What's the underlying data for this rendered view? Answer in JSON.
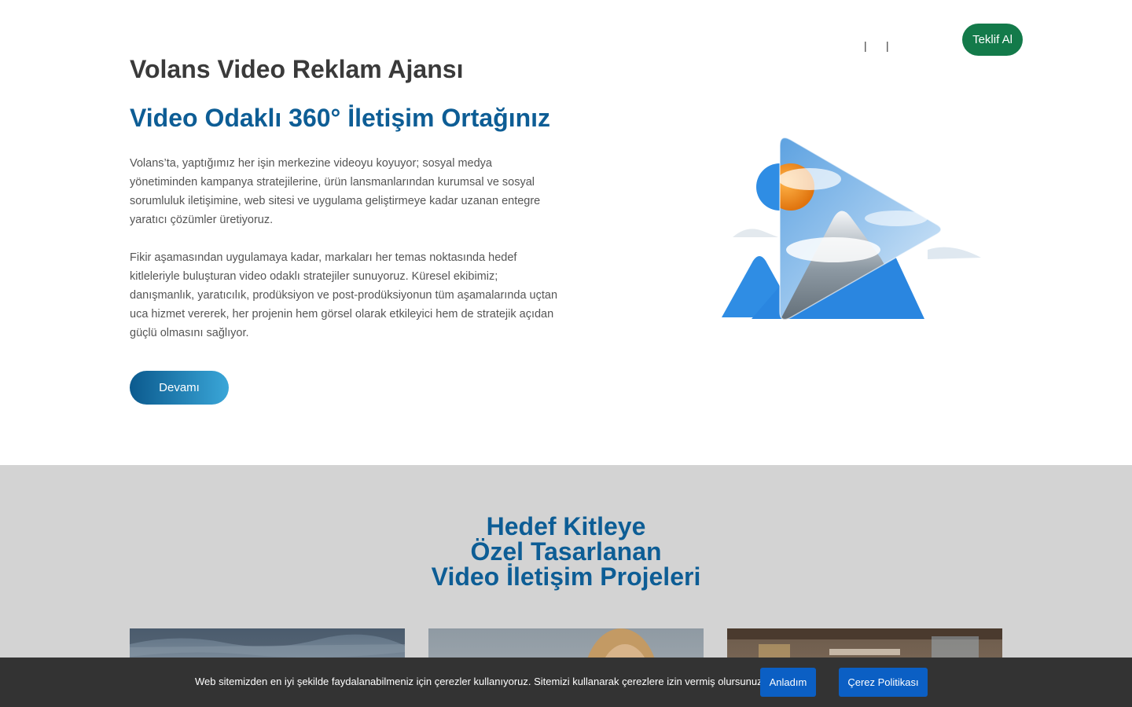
{
  "header": {
    "separators": [
      "|",
      "|"
    ],
    "cta_label": "Teklif Al",
    "cta_color": "#137a4a"
  },
  "hero": {
    "brand": "Volans Video Reklam Ajansı",
    "headline": "Video Odaklı 360° İletişim Ortağınız",
    "paragraph_1": "Volans’ta, yaptığımız her işin merkezine videoyu koyuyor; sosyal medya yönetiminden kampanya stratejilerine, ürün lansmanlarından kurumsal ve sosyal sorumluluk iletişimine, web sitesi ve uygulama geliştirmeye kadar uzanan entegre yaratıcı çözümler üretiyoruz.",
    "paragraph_2": "Fikir aşamasından uygulamaya kadar, markaları her temas noktasında hedef kitleleriyle buluşturan video odaklı stratejiler sunuyoruz. Küresel ekibimiz; danışmanlık, yaratıcılık, prodüksiyon ve post-prodüksiyonun tüm aşamalarında uçtan uca hizmet vererek, her projenin hem görsel olarak etkileyici hem de stratejik açıdan güçlü olmasını sağlıyor.",
    "more_label": "Devamı",
    "accent_color": "#0d5d95"
  },
  "projects": {
    "title_lines": [
      "Hedef Kitleye",
      "Özel Tasarlanan",
      "Video İletişim Projeleri"
    ]
  },
  "cookie": {
    "text": "Web sitemizden en iyi şekilde faydalanabilmeniz için çerezler kullanıyoruz. Sitemizi kullanarak çerezlere izin vermiş olursunuz.",
    "accept_label": "Anladım",
    "policy_label": "Çerez Politikası",
    "button_color": "#0b5fc4"
  }
}
